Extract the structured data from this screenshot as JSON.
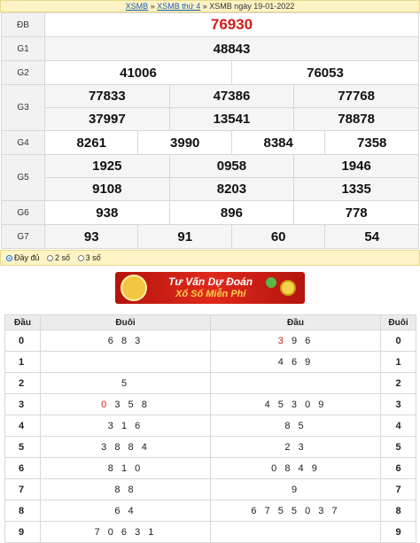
{
  "breadcrumb": {
    "link1": "XSMB",
    "sep1": " » ",
    "link2": "XSMB thứ 4",
    "sep2": " » ",
    "current": "XSMB ngày 19-01-2022"
  },
  "results": {
    "db": {
      "label": "ĐB",
      "value": "76930"
    },
    "g1": {
      "label": "G1",
      "values": [
        "48843"
      ]
    },
    "g2": {
      "label": "G2",
      "values": [
        "41006",
        "76053"
      ]
    },
    "g3": {
      "label": "G3",
      "values": [
        "77833",
        "47386",
        "77768",
        "37997",
        "13541",
        "78878"
      ]
    },
    "g4": {
      "label": "G4",
      "values": [
        "8261",
        "3990",
        "8384",
        "7358"
      ]
    },
    "g5": {
      "label": "G5",
      "values": [
        "1925",
        "0958",
        "1946",
        "9108",
        "8203",
        "1335"
      ]
    },
    "g6": {
      "label": "G6",
      "values": [
        "938",
        "896",
        "778"
      ]
    },
    "g7": {
      "label": "G7",
      "values": [
        "93",
        "91",
        "60",
        "54"
      ]
    }
  },
  "options": {
    "full": "Đầy đủ",
    "two": "2 số",
    "three": "3 số",
    "selected": "full"
  },
  "banner": {
    "line1": "Tư Vấn Dự Đoán",
    "line2": "Xổ Số Miễn Phí"
  },
  "loto": {
    "headers": {
      "dau_left": "Đầu",
      "duoi_left": "Đuôi",
      "dau_right": "Đầu",
      "duoi_right": "Đuôi"
    },
    "rows": [
      {
        "k": "0",
        "tail": "6 8 3",
        "head": "3 9 6",
        "headRed": "3",
        "headRest": "9 6"
      },
      {
        "k": "1",
        "tail": "",
        "head": "4 6 9"
      },
      {
        "k": "2",
        "tail": "5",
        "head": ""
      },
      {
        "k": "3",
        "tail": "0 3 5 8",
        "tailRed": "0",
        "tailRest": "3 5 8",
        "head": "4 5 3 0 9"
      },
      {
        "k": "4",
        "tail": "3 1 6",
        "head": "8 5"
      },
      {
        "k": "5",
        "tail": "3 8 8 4",
        "head": "2 3"
      },
      {
        "k": "6",
        "tail": "8 1 0",
        "head": "0 8 4 9"
      },
      {
        "k": "7",
        "tail": "8 8",
        "head": "9"
      },
      {
        "k": "8",
        "tail": "6 4",
        "head": "6 7 5 5 0 3 7"
      },
      {
        "k": "9",
        "tail": "7 0 6 3 1",
        "head": ""
      }
    ]
  }
}
